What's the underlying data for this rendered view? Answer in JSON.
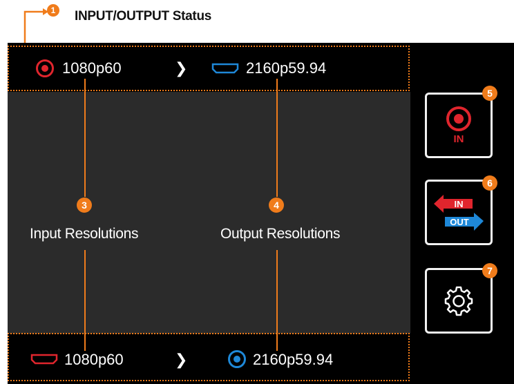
{
  "annotations": {
    "title": "INPUT/OUTPUT Status",
    "marker_1": "1",
    "marker_3": "3",
    "marker_4": "4",
    "marker_5": "5",
    "marker_6": "6",
    "marker_7": "7",
    "input_label": "Input Resolutions",
    "output_label": "Output Resolutions"
  },
  "status_top": {
    "input_resolution": "1080p60",
    "output_resolution": "2160p59.94",
    "separator": "❯",
    "input_icon": "sdi-icon",
    "output_icon": "hdmi-icon"
  },
  "status_bottom": {
    "input_resolution": "1080p60",
    "output_resolution": "2160p59.94",
    "separator": "❯",
    "input_icon": "hdmi-icon",
    "output_icon": "sdi-icon"
  },
  "sidebar": {
    "input_button": {
      "label": "IN",
      "icon": "sdi-icon"
    },
    "swap_button": {
      "in_label": "IN",
      "out_label": "OUT",
      "icon": "swap-arrows-icon"
    },
    "settings_button": {
      "icon": "gear-icon"
    }
  },
  "colors": {
    "accent": "#f07c1b",
    "input_red": "#e0252d",
    "output_blue": "#1e88d8",
    "screen_bg": "#000000",
    "content_bg": "#2b2b2b"
  }
}
